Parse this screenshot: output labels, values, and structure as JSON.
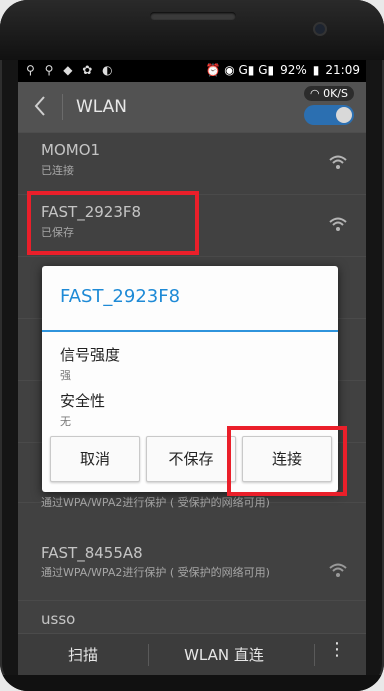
{
  "status_bar": {
    "left_icons": [
      "usb-icon",
      "usb-icon",
      "shield-icon",
      "app-icon",
      "cat-icon"
    ],
    "left_glyphs": "⚲ ⚲ ◆ ✿ ◐",
    "right_glyphs": "⏰ ◉ G▮ G▮",
    "battery": "92%",
    "time": "21:09"
  },
  "action_bar": {
    "title": "WLAN",
    "speed": "0K/S",
    "wifi_toggle_on": true
  },
  "networks": [
    {
      "name": "MOMO1",
      "status": "已连接"
    },
    {
      "name": "FAST_2923F8",
      "status": "已保存"
    },
    {
      "name": "",
      "status": "通过WPA/WPA2进行保护 ( 受保护的网络可用)"
    },
    {
      "name": "FAST_8455A8",
      "status": "通过WPA/WPA2进行保护 ( 受保护的网络可用)"
    },
    {
      "name": "usso",
      "status": ""
    }
  ],
  "dialog": {
    "title": "FAST_2923F8",
    "fields": [
      {
        "label": "信号强度",
        "value": "强"
      },
      {
        "label": "安全性",
        "value": "无"
      }
    ],
    "buttons": {
      "cancel": "取消",
      "forget": "不保存",
      "connect": "连接"
    }
  },
  "bottom_bar": {
    "scan": "扫描",
    "wlan_direct": "WLAN 直连",
    "more_glyph": "⋮"
  },
  "colors": {
    "accent": "#2f94dc",
    "highlight": "#ea1f2a",
    "toggle": "#2b6fb1"
  }
}
